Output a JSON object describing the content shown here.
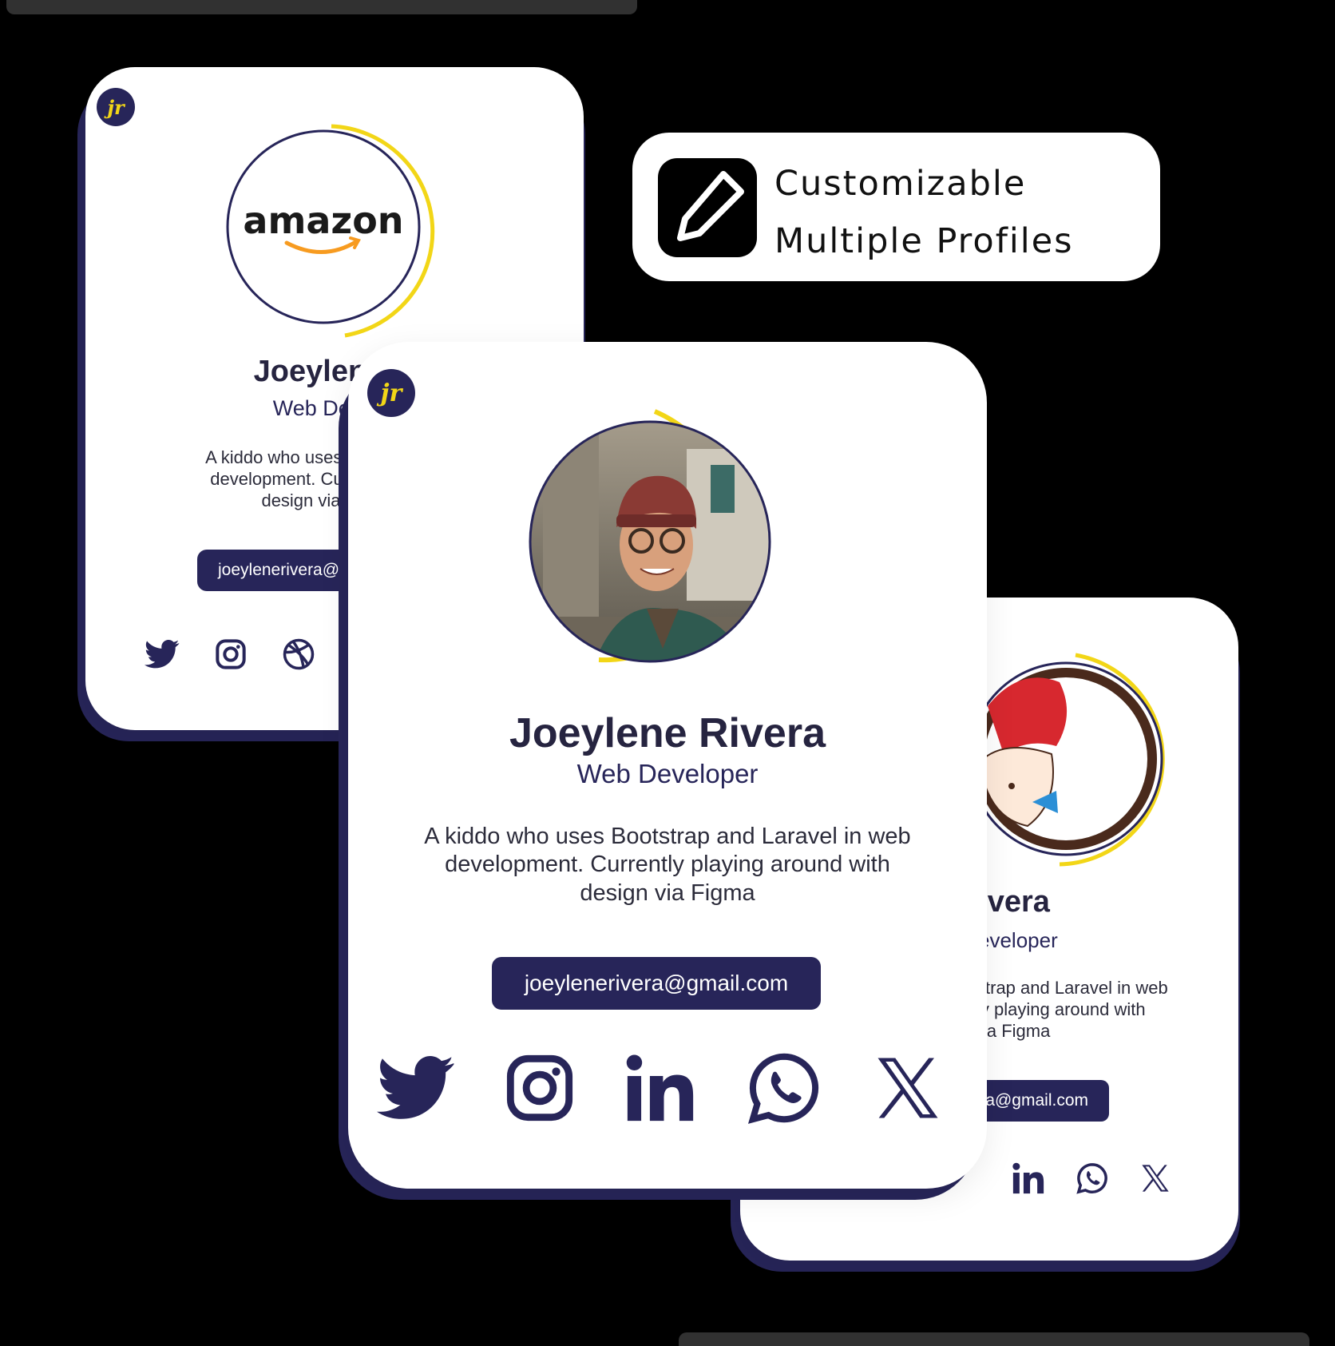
{
  "feature_box": {
    "icon": "edit-pencil-icon",
    "line1": "Customizable",
    "line2": "Multiple Profiles"
  },
  "cards": {
    "left": {
      "logo_badge": "jr",
      "avatar": "amazon-logo",
      "avatar_text": "amazon",
      "name": "Joeylene",
      "role": "Web Dev",
      "bio_lines": [
        "A kiddo who uses Bootst",
        "development. Currently",
        "design via"
      ],
      "email": "joeylenerivera@",
      "socials": [
        "twitter-icon",
        "instagram-icon",
        "dribbble-icon"
      ]
    },
    "center": {
      "logo_badge": "jr",
      "avatar": "person-photo",
      "name": "Joeylene Rivera",
      "role": "Web Developer",
      "bio_lines": [
        "A kiddo who uses Bootstrap and Laravel in web",
        "development. Currently playing around with",
        "design via Figma"
      ],
      "email": "joeylenerivera@gmail.com",
      "socials": [
        "twitter-icon",
        "instagram-icon",
        "linkedin-icon",
        "whatsapp-icon",
        "x-icon"
      ]
    },
    "right": {
      "avatar": "wendys-logo",
      "name": "e Rivera",
      "role": "eveloper",
      "bio_lines": [
        "strap and Laravel in web",
        "ly playing around with",
        "ia Figma"
      ],
      "email": "a@gmail.com",
      "socials": [
        "linkedin-icon",
        "whatsapp-icon",
        "x-icon"
      ]
    }
  },
  "colors": {
    "navy": "#272559",
    "yellow": "#f2d617",
    "amazon_orange": "#f79b20"
  }
}
